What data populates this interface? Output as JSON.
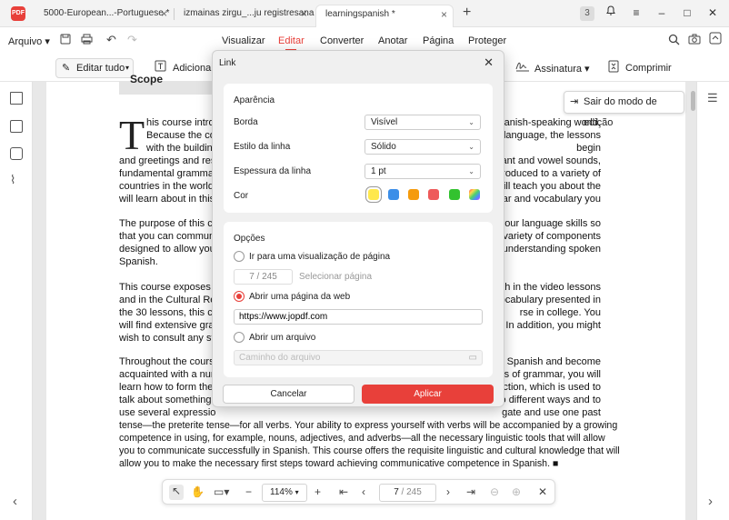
{
  "tabs": [
    {
      "label": "5000-European...-Portuguese *"
    },
    {
      "label": "izmainas zirgu_...ju registresana"
    },
    {
      "label": "learningspanish *"
    }
  ],
  "tab_count_badge": "3",
  "menu": {
    "file": "Arquivo",
    "items": [
      "Visualizar",
      "Editar",
      "Converter",
      "Anotar",
      "Página",
      "Proteger"
    ]
  },
  "toolbar": {
    "edit_all": "Editar tudo",
    "add_text": "Adicionar",
    "signature": "Assinatura",
    "compress": "Comprimir"
  },
  "exit_edit": "Sair do modo de edição",
  "document": {
    "heading": "Scope",
    "dropcap": "T",
    "p1_lines": [
      "his course intro",
      "Because the co",
      "with the buildin",
      "and greetings and res",
      "fundamental grammar",
      "countries in the world",
      "will learn about in this"
    ],
    "p1_right": [
      "panish-speaking world.",
      "e language, the lessons begin",
      "nant and vowel sounds,",
      "troduced to a variety of",
      "will teach you about the",
      "mar and vocabulary you",
      ""
    ],
    "p2": [
      "The purpose of this co",
      "that you can communi",
      "designed to allow you",
      "Spanish."
    ],
    "p2_right": [
      "your language skills so",
      "a variety of components",
      "d understanding spoken",
      ""
    ],
    "p3": [
      "This course exposes l",
      "and in the Cultural Re",
      "the 30 lessons, this co",
      "will find extensive gra",
      "wish to consult any sta"
    ],
    "p3_right": [
      "oth in the video lessons",
      "vocabulary presented in",
      "rse in college. You",
      "k. In addition, you might",
      ""
    ],
    "p4_left": [
      "Throughout the course",
      "acquainted with a num",
      "learn how to form the",
      "talk about something",
      "use several expressio"
    ],
    "p4_right": [
      "n Spanish and become",
      "ms of grammar, you will",
      "uction, which is used to",
      "o different ways and to",
      "gate and use one past"
    ],
    "p4_full": [
      "tense—the preterite tense—for all verbs. Your ability to express yourself with verbs will be accompanied by a growing",
      "competence in using, for example, nouns, adjectives, and adverbs—all the necessary linguistic tools that will allow",
      "you to communicate successfully in Spanish. This course offers the requisite linguistic and cultural knowledge that will",
      "allow you to make the necessary first steps toward achieving communicative competence in Spanish. ■"
    ]
  },
  "bottombar": {
    "zoom": "114%",
    "current_page": "7",
    "total_pages": "/ 245"
  },
  "dialog": {
    "title": "Link",
    "appearance": {
      "title": "Aparência",
      "border_label": "Borda",
      "border_value": "Visível",
      "style_label": "Estilo da linha",
      "style_value": "Sólido",
      "width_label": "Espessura da linha",
      "width_value": "1 pt",
      "color_label": "Cor",
      "colors": [
        "#ffe84d",
        "#3b8ee8",
        "#f59b0c",
        "#ee5a5a",
        "#33c22f",
        "multicolor"
      ],
      "selected_color": "#ffe84d"
    },
    "options": {
      "title": "Opções",
      "go_to_page": "Ir para uma visualização de página",
      "page_value": "7",
      "page_total": "/ 245",
      "select_page": "Selecionar página",
      "open_web": "Abrir uma página da web",
      "url": "https://www.jopdf.com",
      "open_file": "Abrir um arquivo",
      "file_placeholder": "Caminho do arquivo",
      "selected": "open_web"
    },
    "cancel": "Cancelar",
    "apply": "Aplicar"
  }
}
